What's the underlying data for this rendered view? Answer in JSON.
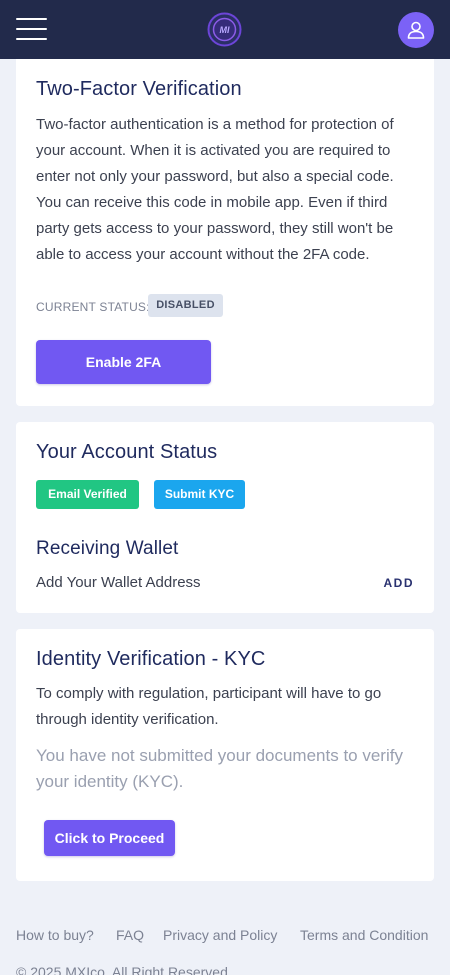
{
  "header": {
    "logo_text": "MI",
    "menu_icon": "hamburger-icon",
    "user_icon": "user-icon",
    "brand_color": "#222a4b",
    "accent_color": "#7b62f6"
  },
  "two_factor": {
    "title": "Two-Factor Verification",
    "description": "Two-factor authentication is a method for protection of your account. When it is activated you are required to enter not only your password, but also a special code. You can receive this code in mobile app. Even if third party gets access to your password, they still won't be able to access your account without the 2FA code.",
    "status_label": "CURRENT STATUS:",
    "status_value": "DISABLED",
    "enable_button": "Enable 2FA"
  },
  "account_status": {
    "title": "Your Account Status",
    "email_badge": "Email Verified",
    "kyc_badge": "Submit KYC",
    "wallet_title": "Receiving Wallet",
    "wallet_text": "Add Your Wallet Address",
    "wallet_action": "ADD"
  },
  "kyc": {
    "title": "Identity Verification - KYC",
    "description": "To comply with regulation, participant will have to go through identity verification.",
    "notice": "You have not submitted your documents to verify your identity (KYC).",
    "proceed_button": "Click to Proceed"
  },
  "footer": {
    "links": [
      "How to buy?",
      "FAQ",
      "Privacy and Policy",
      "Terms and Condition"
    ],
    "copyright": "© 2025 MXIco. All Right Reserved."
  }
}
